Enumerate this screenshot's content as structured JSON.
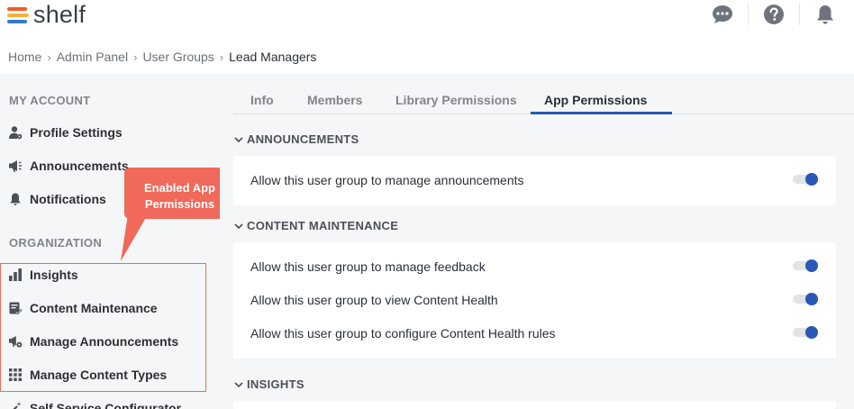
{
  "app": {
    "logo_text": "shelf"
  },
  "topbar": {
    "icons": [
      "chat-icon",
      "help-icon",
      "bell-icon"
    ]
  },
  "breadcrumb": [
    "Home",
    "Admin Panel",
    "User Groups",
    "Lead Managers"
  ],
  "sidebar": {
    "my_account_title": "MY ACCOUNT",
    "my_account_items": [
      {
        "label": "Profile Settings",
        "icon": "user-settings-icon"
      },
      {
        "label": "Announcements",
        "icon": "megaphone-icon"
      },
      {
        "label": "Notifications",
        "icon": "bell-icon"
      }
    ],
    "organization_title": "ORGANIZATION",
    "organization_items": [
      {
        "label": "Insights",
        "icon": "bar-chart-icon"
      },
      {
        "label": "Content Maintenance",
        "icon": "clipboard-check-icon"
      },
      {
        "label": "Manage Announcements",
        "icon": "megaphone-gear-icon"
      },
      {
        "label": "Manage Content Types",
        "icon": "grid-icon"
      },
      {
        "label": "Self Service Configurator",
        "icon": "wand-icon"
      }
    ]
  },
  "callout": {
    "line1": "Enabled App",
    "line2": "Permissions",
    "color": "#f0695a"
  },
  "tabs": [
    {
      "label": "Info",
      "active": false
    },
    {
      "label": "Members",
      "active": false
    },
    {
      "label": "Library Permissions",
      "active": false
    },
    {
      "label": "App Permissions",
      "active": true
    }
  ],
  "groups": [
    {
      "title": "ANNOUNCEMENTS",
      "permissions": [
        {
          "label": "Allow this user group to manage announcements",
          "enabled": true
        }
      ]
    },
    {
      "title": "CONTENT MAINTENANCE",
      "permissions": [
        {
          "label": "Allow this user group to manage feedback",
          "enabled": true
        },
        {
          "label": "Allow this user group to view Content Health",
          "enabled": true
        },
        {
          "label": "Allow this user group to configure Content Health rules",
          "enabled": true
        }
      ]
    },
    {
      "title": "INSIGHTS",
      "permissions": []
    }
  ],
  "colors": {
    "accent": "#2a58b5",
    "highlight": "#e86f5a"
  }
}
